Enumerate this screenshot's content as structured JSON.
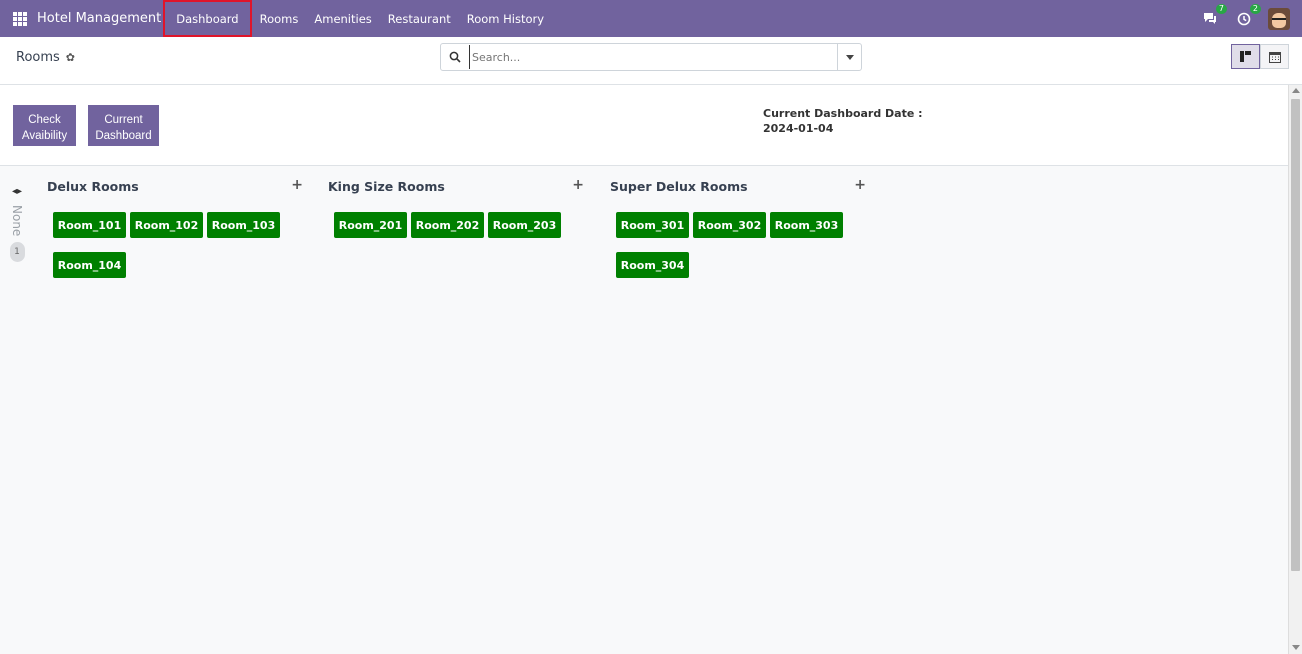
{
  "navbar": {
    "brand": "Hotel Management",
    "menu": [
      {
        "label": "Dashboard"
      },
      {
        "label": "Rooms"
      },
      {
        "label": "Amenities"
      },
      {
        "label": "Restaurant"
      },
      {
        "label": "Room History"
      }
    ],
    "messages_count": "7",
    "activities_count": "2"
  },
  "control_panel": {
    "breadcrumb": "Rooms",
    "search_placeholder": "Search..."
  },
  "dashboard": {
    "check_btn_line1": "Check",
    "check_btn_line2": "Avaibility",
    "current_btn_line1": "Current",
    "current_btn_line2": "Dashboard",
    "date_label": "Current Dashboard Date :",
    "date_value": "2024-01-04"
  },
  "kanban": {
    "folded_label": "None",
    "folded_count": "1",
    "groups": [
      {
        "title": "Delux Rooms",
        "rooms": [
          "Room_101",
          "Room_102",
          "Room_103",
          "Room_104"
        ]
      },
      {
        "title": "King Size Rooms",
        "rooms": [
          "Room_201",
          "Room_202",
          "Room_203"
        ]
      },
      {
        "title": "Super Delux Rooms",
        "rooms": [
          "Room_301",
          "Room_302",
          "Room_303",
          "Room_304"
        ]
      }
    ]
  },
  "colors": {
    "navbar": "#71639e",
    "room_card": "#008000",
    "active_outline": "#e0142a"
  }
}
